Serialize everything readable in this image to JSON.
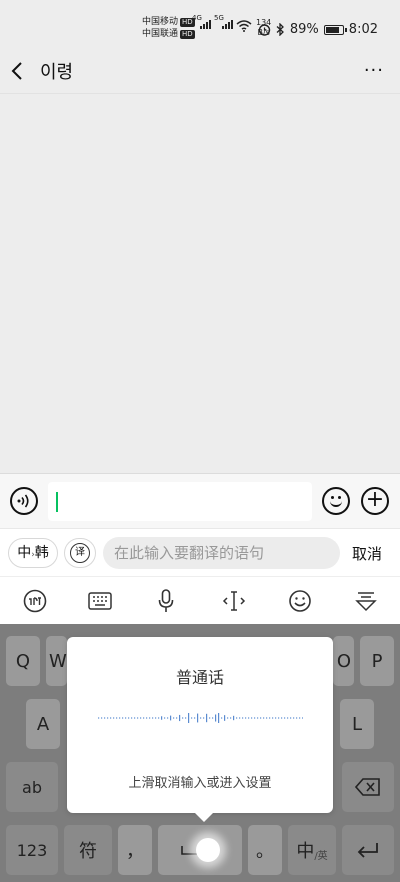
{
  "status_bar": {
    "carrier1": "中国移动",
    "carrier2": "中国联通",
    "hd": "HD",
    "net1": "4G",
    "net2": "5G",
    "speed_value": "134",
    "speed_unit": "B/s",
    "battery": "89%",
    "battery_level": 0.89,
    "time": "8:02"
  },
  "header": {
    "title": "이령",
    "more": "···"
  },
  "input_bar": {
    "value": ""
  },
  "translate_bar": {
    "lang_from": "中",
    "lang_to": "韩",
    "tr_icon_label": "译",
    "placeholder": "在此输入要翻译的语句",
    "cancel": "取消"
  },
  "keyboard_toolbar": {
    "items": [
      "xunfei-logo",
      "keyboard",
      "microphone",
      "text-cursor",
      "emoji",
      "collapse"
    ]
  },
  "keyboard": {
    "row1": [
      "Q",
      "W",
      "O",
      "P"
    ],
    "row2": [
      "A",
      "L"
    ],
    "row3_left": "ab",
    "key_123": "123",
    "key_symbol": "符",
    "key_comma": "，",
    "key_period": "。",
    "key_lang_main": "中",
    "key_lang_sub": "/英"
  },
  "voice_popup": {
    "title": "普通话",
    "hint": "上滑取消输入或进入设置"
  }
}
